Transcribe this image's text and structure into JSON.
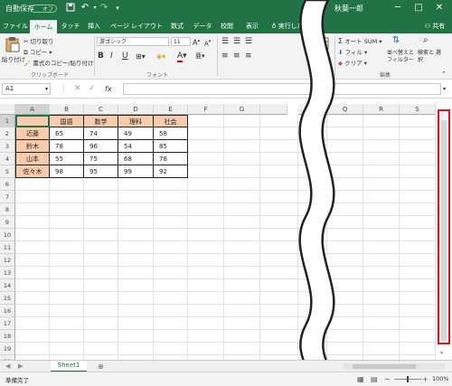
{
  "titlebar": {
    "autosave_label": "自動保存",
    "autosave_state": "オフ",
    "account_name": "秋葉一郎",
    "icons": [
      "save-icon",
      "undo-icon",
      "redo-icon",
      "customize-qat-icon",
      "minimize-icon",
      "maximize-icon",
      "close-icon"
    ]
  },
  "tabs": [
    "ファイル",
    "ホーム",
    "タッチ",
    "挿入",
    "ページ レイアウト",
    "数式",
    "データ",
    "校閲",
    "表示",
    "実行した"
  ],
  "share_label": "共有",
  "ribbon": {
    "paste": "貼り付け",
    "cut": "切り取り",
    "copy": "コピー",
    "format_painter": "書式のコピー/貼り付け",
    "clipboard_group": "クリップボード",
    "font_name": "游ゴシック",
    "font_size": "11",
    "bold": "B",
    "italic": "I",
    "underline": "U",
    "font_color": "A",
    "font_group": "フォント",
    "styles": "書式",
    "autosum": "オート SUM",
    "fill": "フィル",
    "clear": "クリア",
    "sort_filter": "並べ替えと フィルター",
    "find_select": "検索と 選択",
    "editing_group": "編集"
  },
  "formula_bar": {
    "name_box": "A1",
    "fx": "fx",
    "value": ""
  },
  "grid": {
    "left_columns": [
      "A",
      "B",
      "C",
      "D",
      "E",
      "F",
      "G"
    ],
    "right_columns": [
      "P",
      "Q",
      "R",
      "S"
    ],
    "rows": [
      "1",
      "2",
      "3",
      "4",
      "5",
      "6",
      "7",
      "8",
      "9",
      "10",
      "11",
      "12",
      "13",
      "14",
      "15",
      "16",
      "17",
      "18",
      "19",
      "20"
    ],
    "table_header": [
      "",
      "国語",
      "数学",
      "理科",
      "社会"
    ],
    "table_rows": [
      {
        "name": "近藤",
        "values": [
          "65",
          "74",
          "49",
          "58"
        ]
      },
      {
        "name": "鈴木",
        "values": [
          "78",
          "96",
          "54",
          "85"
        ]
      },
      {
        "name": "山本",
        "values": [
          "55",
          "75",
          "68",
          "78"
        ]
      },
      {
        "name": "佐々木",
        "values": [
          "98",
          "95",
          "99",
          "92"
        ]
      }
    ],
    "header_fill": "#f8cbad"
  },
  "sheets": [
    "Sheet1"
  ],
  "status": {
    "ready": "準備完了",
    "zoom": "100%"
  },
  "colors": {
    "excel_green": "#217346",
    "highlight_red": "#e8101a"
  }
}
